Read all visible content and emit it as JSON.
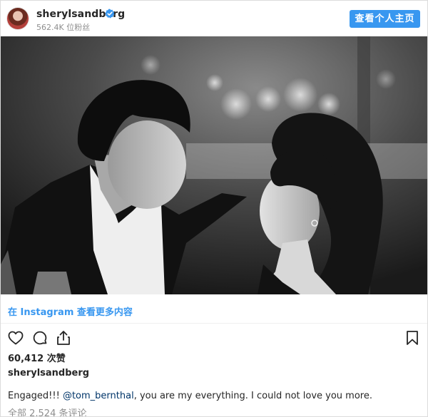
{
  "header": {
    "username": "sherylsandberg",
    "followers": "562.4K 位粉丝",
    "profile_button": "查看个人主页"
  },
  "instagram_link": "在 Instagram 查看更多内容",
  "actions": {
    "like": "heart-icon",
    "comment": "comment-icon",
    "share": "share-icon",
    "save": "bookmark-icon"
  },
  "likes": "60,412 次赞",
  "post_username": "sherylsandberg",
  "caption": {
    "prefix": "Engaged!!! ",
    "mention": "@tom_bernthal",
    "suffix": ", you are my everything. I could not love you more."
  },
  "comments_label": "全部 2,524 条评论",
  "colors": {
    "accent": "#3897f0",
    "mention": "#003569",
    "muted": "#8e8e8e",
    "text": "#262626"
  }
}
